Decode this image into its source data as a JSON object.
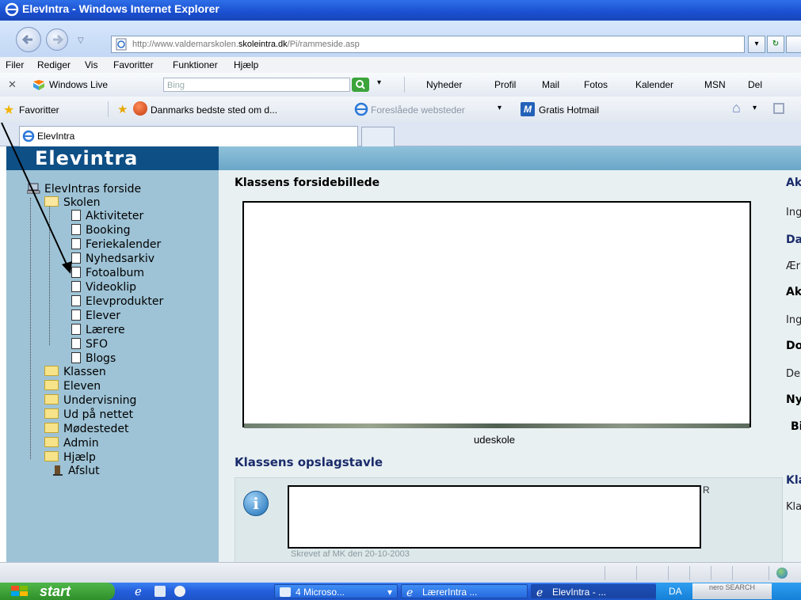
{
  "window": {
    "title": "ElevIntra - Windows Internet Explorer"
  },
  "address": {
    "url_prefix": "http://www.valdemarskolen.",
    "url_domain": "skoleintra.dk",
    "url_path": "/Pi/rammeside.asp"
  },
  "menu": [
    "Filer",
    "Rediger",
    "Vis",
    "Favoritter",
    "Funktioner",
    "Hjælp"
  ],
  "livebar": {
    "brand": "Windows Live",
    "search_placeholder": "Bing",
    "links": [
      "Nyheder",
      "Profil",
      "Mail",
      "Fotos",
      "Kalender",
      "MSN",
      "Del"
    ]
  },
  "favbar": {
    "favorites": "Favoritter",
    "item1": "Danmarks bedste sted om d...",
    "item2": "Foreslåede websteder",
    "item3": "Gratis Hotmail"
  },
  "tab": {
    "label": "ElevIntra"
  },
  "brand": "Elevintra",
  "sidebar": {
    "home": "ElevIntras forside",
    "skolen": "Skolen",
    "skolen_items": [
      "Aktiviteter",
      "Booking",
      "Feriekalender",
      "Nyhedsarkiv",
      "Fotoalbum",
      "Videoklip",
      "Elevprodukter",
      "Elever",
      "Lærere",
      "SFO",
      "Blogs"
    ],
    "folders": [
      "Klassen",
      "Eleven",
      "Undervisning",
      "Ud på nettet",
      "Mødestedet",
      "Admin",
      "Hjælp"
    ],
    "exit": "Afslut"
  },
  "content": {
    "photo_title": "Klassens forsidebillede",
    "photo_caption": "udeskole",
    "board_title": "Klassens opslagstavle",
    "board_r": "R",
    "board_meta": "Skrevet af MK den 20-10-2003"
  },
  "rightcol": {
    "items": [
      {
        "text": "Ak",
        "style": "blue"
      },
      {
        "text": "Ing",
        "style": "normal"
      },
      {
        "text": "Da",
        "style": "blue"
      },
      {
        "text": "Ær",
        "style": "normal"
      },
      {
        "text": "Ak",
        "style": "black"
      },
      {
        "text": "Ing",
        "style": "normal"
      },
      {
        "text": "Do",
        "style": "black"
      },
      {
        "text": "De",
        "style": "normal"
      },
      {
        "text": "Ny",
        "style": "black"
      },
      {
        "text": "Bil",
        "style": "black"
      },
      {
        "text": "Kla",
        "style": "blue"
      },
      {
        "text": "Kla",
        "style": "normal"
      }
    ]
  },
  "taskbar": {
    "start": "start",
    "tasks": [
      "4 Microso...",
      "LærerIntra ...",
      "ElevIntra - ..."
    ],
    "tray_lang": "DA",
    "nero": "nero SEARCH"
  },
  "colors": {
    "brand_bg": "#0e4f86",
    "sidebar_bg": "#9ec3d6",
    "section_title": "#1a2c6b"
  }
}
